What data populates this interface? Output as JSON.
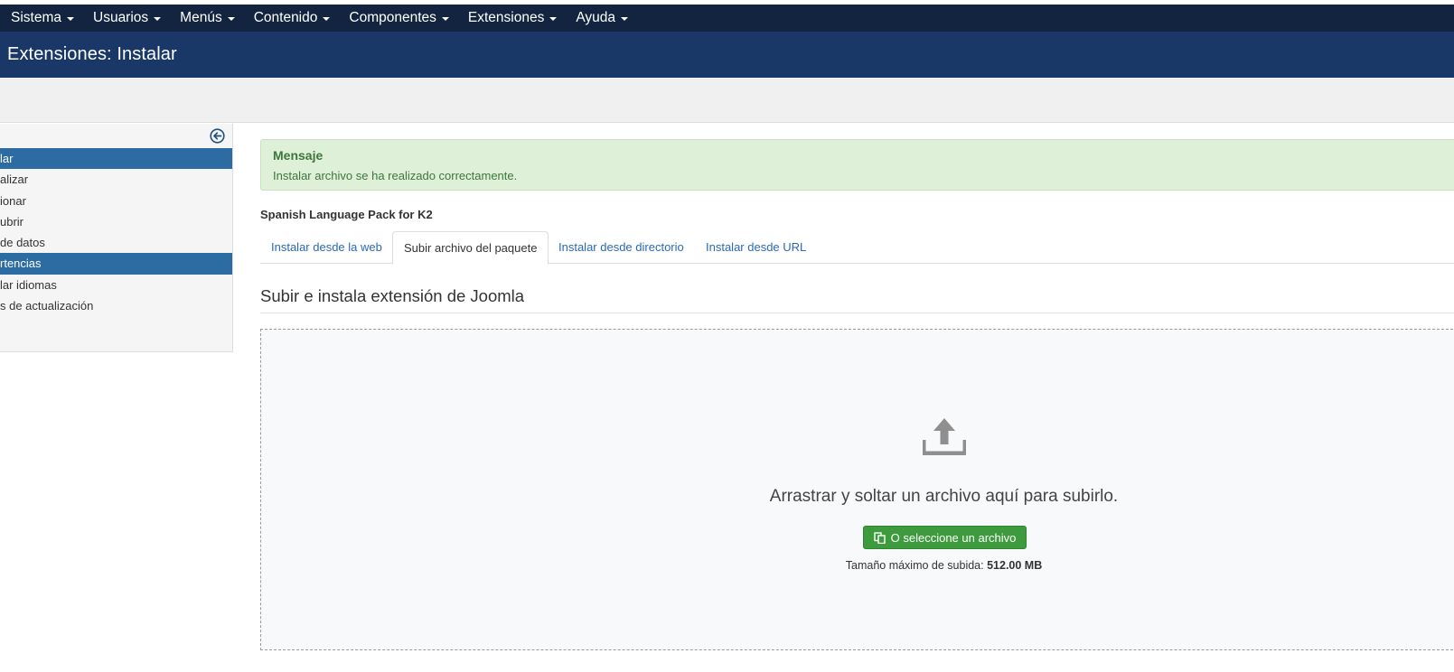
{
  "topbar": {
    "menu": [
      {
        "label": "Sistema"
      },
      {
        "label": "Usuarios"
      },
      {
        "label": "Menús"
      },
      {
        "label": "Contenido"
      },
      {
        "label": "Componentes"
      },
      {
        "label": "Extensiones"
      },
      {
        "label": "Ayuda"
      }
    ]
  },
  "header": {
    "title": "Extensiones: Instalar"
  },
  "sidebar": {
    "toggle_icon": "circle-arrow-left-icon",
    "items": [
      {
        "label": "lar",
        "active": true
      },
      {
        "label": "alizar",
        "active": false
      },
      {
        "label": "ionar",
        "active": false
      },
      {
        "label": "ubrir",
        "active": false
      },
      {
        "label": " de datos",
        "active": false
      },
      {
        "label": "rtencias",
        "active": true
      },
      {
        "label": "lar idiomas",
        "active": false
      },
      {
        "label": "s de actualización",
        "active": false
      }
    ]
  },
  "alert": {
    "title": "Mensaje",
    "body": "Instalar archivo se ha realizado correctamente."
  },
  "package_title": "Spanish Language Pack for K2",
  "tabs": [
    {
      "label": "Instalar desde la web",
      "active": false
    },
    {
      "label": "Subir archivo del paquete",
      "active": true
    },
    {
      "label": "Instalar desde directorio",
      "active": false
    },
    {
      "label": "Instalar desde URL",
      "active": false
    }
  ],
  "upload": {
    "section_title": "Subir e instala extensión de Joomla",
    "drop_text": "Arrastrar y soltar un archivo aquí para subirlo.",
    "button_label": "O seleccione un archivo",
    "max_size_label": "Tamaño máximo de subida:",
    "max_size_value": "512.00 MB"
  },
  "colors": {
    "topbar": "#12243f",
    "header": "#1a3867",
    "active_item": "#2d6ca2",
    "link": "#2a69b8",
    "success_bg": "#dff0d8",
    "success_text": "#3c763d",
    "button_green": "#3d9a3d"
  }
}
